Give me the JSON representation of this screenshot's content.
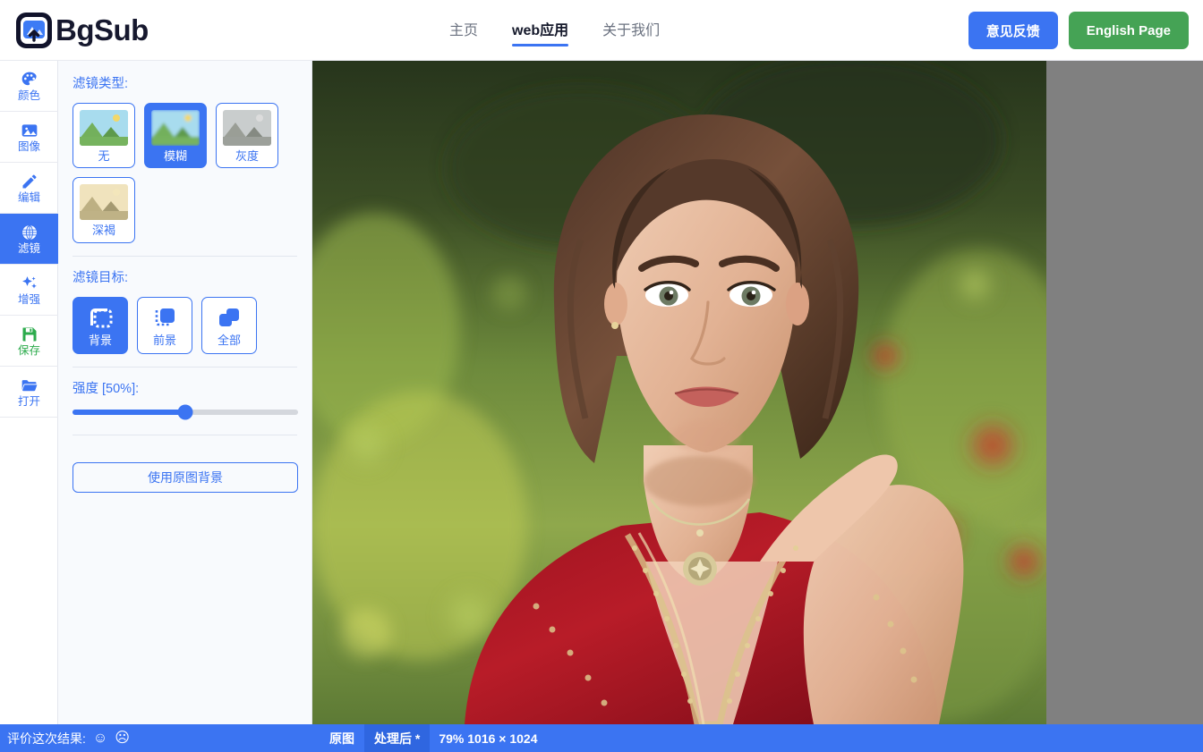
{
  "header": {
    "brand_name": "BgSub",
    "brand_logo_icon": "image-upload-icon",
    "nav": [
      {
        "label": "主页",
        "name": "nav-home",
        "active": false
      },
      {
        "label": "web应用",
        "name": "nav-webapp",
        "active": true
      },
      {
        "label": "关于我们",
        "name": "nav-about",
        "active": false
      }
    ],
    "feedback_label": "意见反馈",
    "english_label": "English Page",
    "accent_blue": "#3b74f2",
    "accent_green": "#45a355"
  },
  "rail": {
    "items": [
      {
        "label": "颜色",
        "icon": "palette-icon",
        "name": "sidebar-item-color",
        "active": false,
        "color": "#3b74f2"
      },
      {
        "label": "图像",
        "icon": "image-icon",
        "name": "sidebar-item-image",
        "active": false,
        "color": "#3b74f2"
      },
      {
        "label": "编辑",
        "icon": "pencil-icon",
        "name": "sidebar-item-edit",
        "active": false,
        "color": "#3b74f2"
      },
      {
        "label": "滤镜",
        "icon": "filter-globe-icon",
        "name": "sidebar-item-filter",
        "active": true,
        "color": "#ffffff"
      },
      {
        "label": "增强",
        "icon": "sparkles-icon",
        "name": "sidebar-item-enhance",
        "active": false,
        "color": "#3b74f2"
      },
      {
        "label": "保存",
        "icon": "floppy-save-icon",
        "name": "sidebar-item-save",
        "active": false,
        "color": "#2cab4c"
      },
      {
        "label": "打开",
        "icon": "folder-open-icon",
        "name": "sidebar-item-open",
        "active": false,
        "color": "#3b74f2"
      }
    ]
  },
  "panel": {
    "filter_type_label": "滤镜类型:",
    "filter_types": [
      {
        "label": "无",
        "name": "filter-type-none",
        "active": false,
        "thumb": "landscape-color"
      },
      {
        "label": "模糊",
        "name": "filter-type-blur",
        "active": true,
        "thumb": "landscape-blur"
      },
      {
        "label": "灰度",
        "name": "filter-type-grayscale",
        "active": false,
        "thumb": "landscape-gray"
      },
      {
        "label": "深褐",
        "name": "filter-type-sepia",
        "active": false,
        "thumb": "landscape-sepia"
      }
    ],
    "filter_target_label": "滤镜目标:",
    "filter_targets": [
      {
        "label": "背景",
        "name": "filter-target-background",
        "active": true,
        "icon": "dashed-square-icon"
      },
      {
        "label": "前景",
        "name": "filter-target-foreground",
        "active": false,
        "icon": "filled-square-dashed-icon"
      },
      {
        "label": "全部",
        "name": "filter-target-all",
        "active": false,
        "icon": "overlapping-squares-icon"
      }
    ],
    "strength_label": "强度 [50%]:",
    "strength_value": 50,
    "use_original_bg_label": "使用原图背景"
  },
  "statusbar": {
    "rate_label": "评价这次结果:",
    "rate_positive_icon": "smiley-face-icon",
    "rate_negative_icon": "frowny-face-icon",
    "rate_positive_glyph": "☺",
    "rate_negative_glyph": "☹",
    "tabs": [
      {
        "label": "原图",
        "name": "status-tab-original",
        "active": false
      },
      {
        "label": "处理后 *",
        "name": "status-tab-processed",
        "active": true
      }
    ],
    "zoom_and_size": "79% 1016 × 1024"
  },
  "canvas": {
    "background_color": "#808080",
    "image_alt": "portrait-woman-red-dress-garden"
  }
}
